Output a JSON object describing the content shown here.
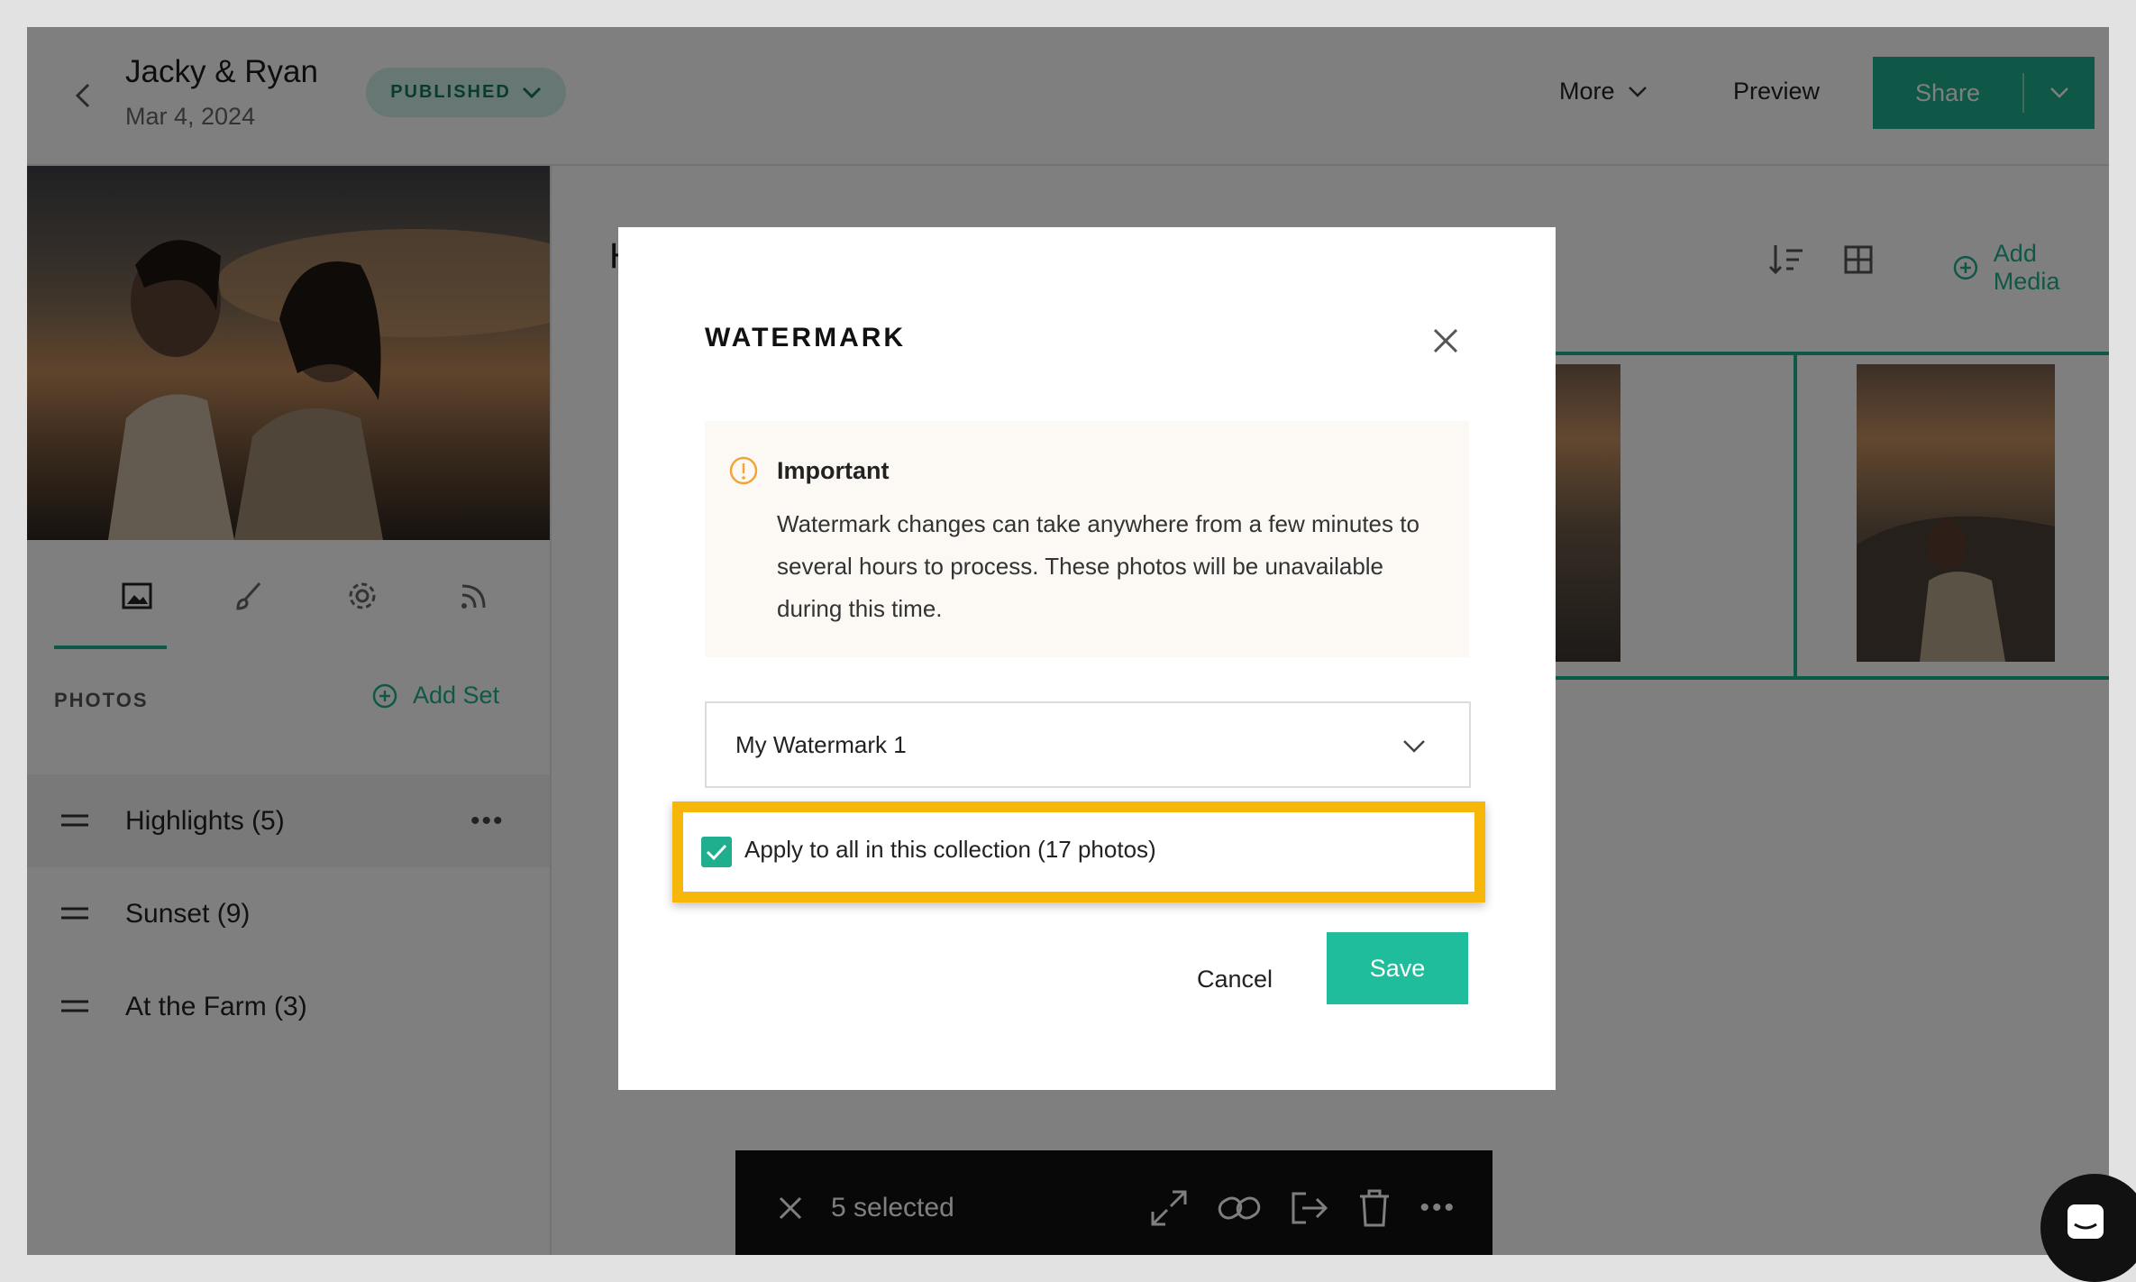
{
  "header": {
    "title": "Jacky & Ryan",
    "date": "Mar 4, 2024",
    "status": "PUBLISHED",
    "more_label": "More",
    "preview_label": "Preview",
    "share_label": "Share"
  },
  "sidebar": {
    "section_label": "PHOTOS",
    "add_set_label": "Add Set",
    "tabs": [
      "photos-icon",
      "brush-icon",
      "gear-icon",
      "feed-icon"
    ],
    "sets": [
      {
        "label": "Highlights (5)",
        "active": true
      },
      {
        "label": "Sunset (9)",
        "active": false
      },
      {
        "label": "At the Farm (3)",
        "active": false
      }
    ]
  },
  "main": {
    "add_media_label": "Add Media",
    "grid_heading_initial": "H"
  },
  "selection_bar": {
    "count_label": "5 selected"
  },
  "modal": {
    "title": "WATERMARK",
    "notice_title": "Important",
    "notice_body": "Watermark changes can take anywhere from a few minutes to several hours to process. These photos will be unavailable during this time.",
    "selected_watermark": "My Watermark 1",
    "apply_all_label": "Apply to all in this collection (17 photos)",
    "apply_all_checked": true,
    "cancel_label": "Cancel",
    "save_label": "Save"
  },
  "colors": {
    "accent": "#1fae8e",
    "save": "#1fbd9b",
    "highlight": "#f7b70a",
    "status_bg": "#cfeee6",
    "notice_icon": "#f0a53a"
  }
}
